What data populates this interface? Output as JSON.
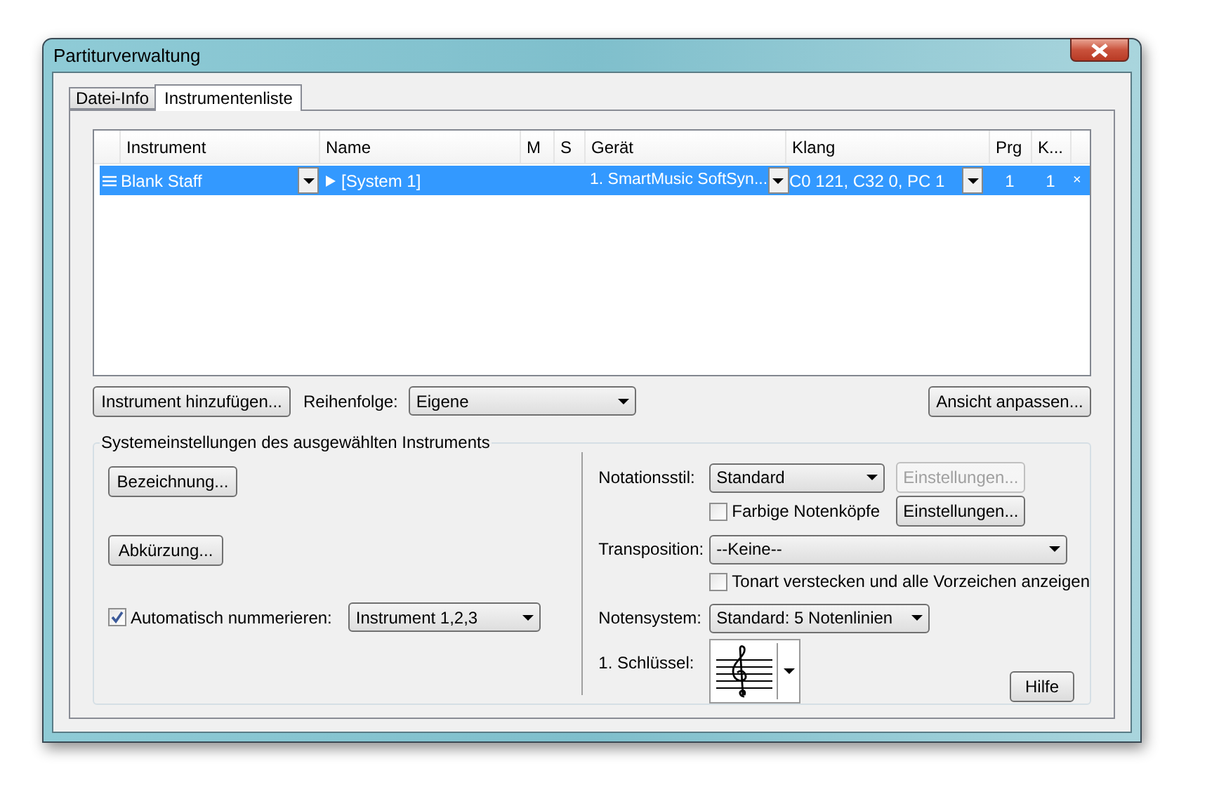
{
  "window": {
    "title": "Partiturverwaltung"
  },
  "tabs": [
    {
      "label": "Datei-Info",
      "selected": false
    },
    {
      "label": "Instrumentenliste",
      "selected": true
    }
  ],
  "table": {
    "columns": [
      "Instrument",
      "Name",
      "M",
      "S",
      "Gerät",
      "Klang",
      "Prg",
      "K..."
    ],
    "rows": [
      {
        "selected": true,
        "instrument": "Blank Staff",
        "name": "[System 1]",
        "device": "1. SmartMusic SoftSyn...",
        "sound": "C0 121, C32 0, PC 1",
        "prg": "1",
        "k": "1",
        "delete": "×"
      }
    ]
  },
  "add_button": "Instrument hinzufügen...",
  "order": {
    "label": "Reihenfolge:",
    "value": "Eigene"
  },
  "view_button": "Ansicht anpassen...",
  "group": {
    "title": "Systemeinstellungen des ausgewählten Instruments",
    "name_button": "Bezeichnung...",
    "abbr_button": "Abkürzung...",
    "auto_number": {
      "label": "Automatisch nummerieren:",
      "checked": true,
      "value": "Instrument 1,2,3"
    },
    "notation_style": {
      "label": "Notationsstil:",
      "value": "Standard",
      "settings_button": {
        "label": "Einstellungen...",
        "disabled": true
      }
    },
    "colored_noteheads": {
      "label": "Farbige Notenköpfe",
      "checked": false
    },
    "settings_button": {
      "label": "Einstellungen...",
      "disabled": false
    },
    "transposition": {
      "label": "Transposition:",
      "value": "--Keine--"
    },
    "hide_key": {
      "label": "Tonart verstecken und alle Vorzeichen anzeigen",
      "checked": false
    },
    "staff_system": {
      "label": "Notensystem:",
      "value": "Standard: 5 Notenlinien"
    },
    "clef": {
      "label": "1. Schlüssel:"
    },
    "help_button": "Hilfe"
  }
}
